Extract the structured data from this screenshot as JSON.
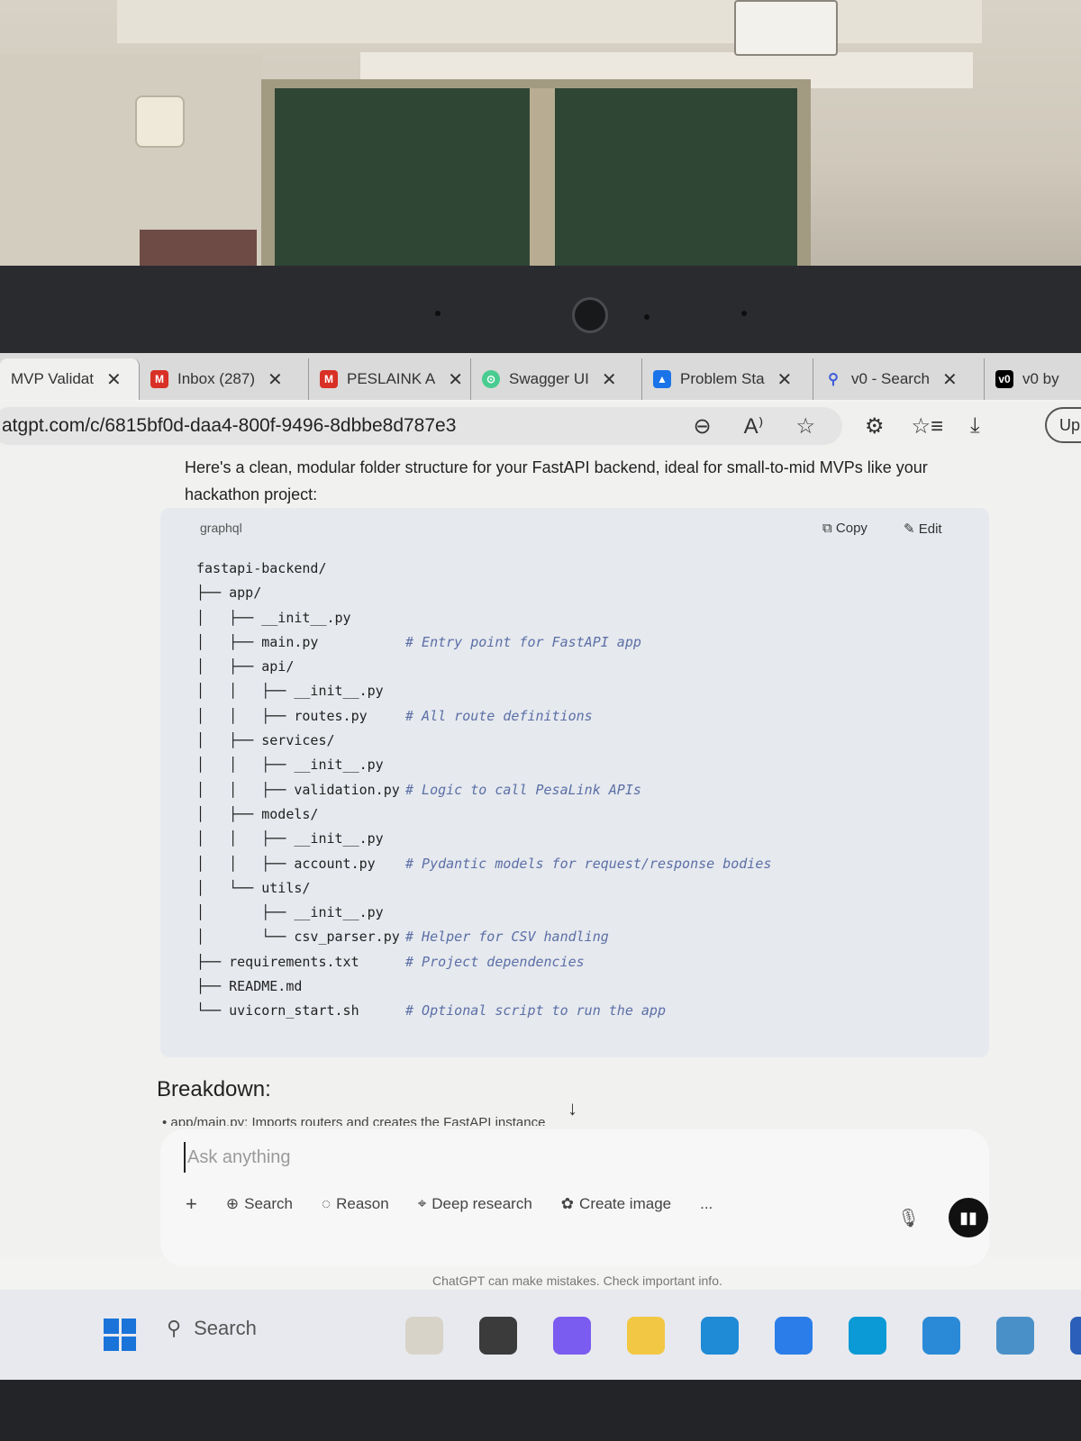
{
  "browser": {
    "tabs": [
      {
        "label": "MVP Validat",
        "icon": "chatgpt-icon",
        "color": "#10a37f",
        "active": true
      },
      {
        "label": "Inbox (287)",
        "icon": "gmail-icon",
        "color": "#d93025"
      },
      {
        "label": "PESLAINK A",
        "icon": "gmail-icon",
        "color": "#d93025"
      },
      {
        "label": "Swagger UI",
        "icon": "swagger-icon",
        "color": "#49cc90"
      },
      {
        "label": "Problem Sta",
        "icon": "drive-icon",
        "color": "#1a73e8"
      },
      {
        "label": "v0 - Search",
        "icon": "search-icon",
        "color": "#3b5bdb"
      },
      {
        "label": "v0 by",
        "icon": "v0-icon",
        "color": "#000000"
      }
    ],
    "url": "atgpt.com/c/6815bf0d-daa4-800f-9496-8dbbe8d787e3",
    "profile_label": "Up"
  },
  "chat": {
    "intro": "Here's a clean, modular folder structure for your FastAPI backend, ideal for small-to-mid MVPs like your hackathon project:",
    "code_lang": "graphql",
    "copy_label": "Copy",
    "edit_label": "Edit",
    "code_lines": [
      {
        "path": "fastapi-backend/",
        "comment": ""
      },
      {
        "path": "├── app/",
        "comment": ""
      },
      {
        "path": "│   ├── __init__.py",
        "comment": ""
      },
      {
        "path": "│   ├── main.py",
        "comment": "# Entry point for FastAPI app"
      },
      {
        "path": "│   ├── api/",
        "comment": ""
      },
      {
        "path": "│   │   ├── __init__.py",
        "comment": ""
      },
      {
        "path": "│   │   ├── routes.py",
        "comment": "# All route definitions"
      },
      {
        "path": "│   ├── services/",
        "comment": ""
      },
      {
        "path": "│   │   ├── __init__.py",
        "comment": ""
      },
      {
        "path": "│   │   ├── validation.py",
        "comment": "# Logic to call PesaLink APIs"
      },
      {
        "path": "│   ├── models/",
        "comment": ""
      },
      {
        "path": "│   │   ├── __init__.py",
        "comment": ""
      },
      {
        "path": "│   │   ├── account.py",
        "comment": "# Pydantic models for request/response bodies"
      },
      {
        "path": "│   └── utils/",
        "comment": ""
      },
      {
        "path": "│       ├── __init__.py",
        "comment": ""
      },
      {
        "path": "│       └── csv_parser.py",
        "comment": "# Helper for CSV handling"
      },
      {
        "path": "├── requirements.txt",
        "comment": "# Project dependencies"
      },
      {
        "path": "├── README.md",
        "comment": ""
      },
      {
        "path": "└── uvicorn_start.sh",
        "comment": "# Optional script to run the app"
      }
    ],
    "breakdown_title": "Breakdown:",
    "breakdown_first": "app/main.py: Imports routers and creates the FastAPI instance"
  },
  "composer": {
    "placeholder": "Ask anything",
    "tools": [
      {
        "label": "Search",
        "icon": "globe-icon"
      },
      {
        "label": "Reason",
        "icon": "lightbulb-icon"
      },
      {
        "label": "Deep research",
        "icon": "telescope-icon"
      },
      {
        "label": "Create image",
        "icon": "palette-icon"
      }
    ],
    "more_label": "...",
    "disclaimer": "ChatGPT can make mistakes. Check important info."
  },
  "taskbar": {
    "search_label": "Search",
    "apps": [
      {
        "icon": "owl-app-icon",
        "color": "#d7d3c8"
      },
      {
        "icon": "launcher-icon",
        "color": "#3b3b3b"
      },
      {
        "icon": "copilot-icon",
        "color": "#7a5cf0"
      },
      {
        "icon": "file-explorer-icon",
        "color": "#f2c744"
      },
      {
        "icon": "edge-dev-icon",
        "color": "#1f8ad6"
      },
      {
        "icon": "store-icon",
        "color": "#2b7de9"
      },
      {
        "icon": "edge-icon",
        "color": "#0b9ad6"
      },
      {
        "icon": "vscode-icon",
        "color": "#2a8ad8"
      },
      {
        "icon": "notepad-icon",
        "color": "#4a90c8"
      },
      {
        "icon": "word-icon",
        "color": "#2b5fb9"
      }
    ]
  }
}
